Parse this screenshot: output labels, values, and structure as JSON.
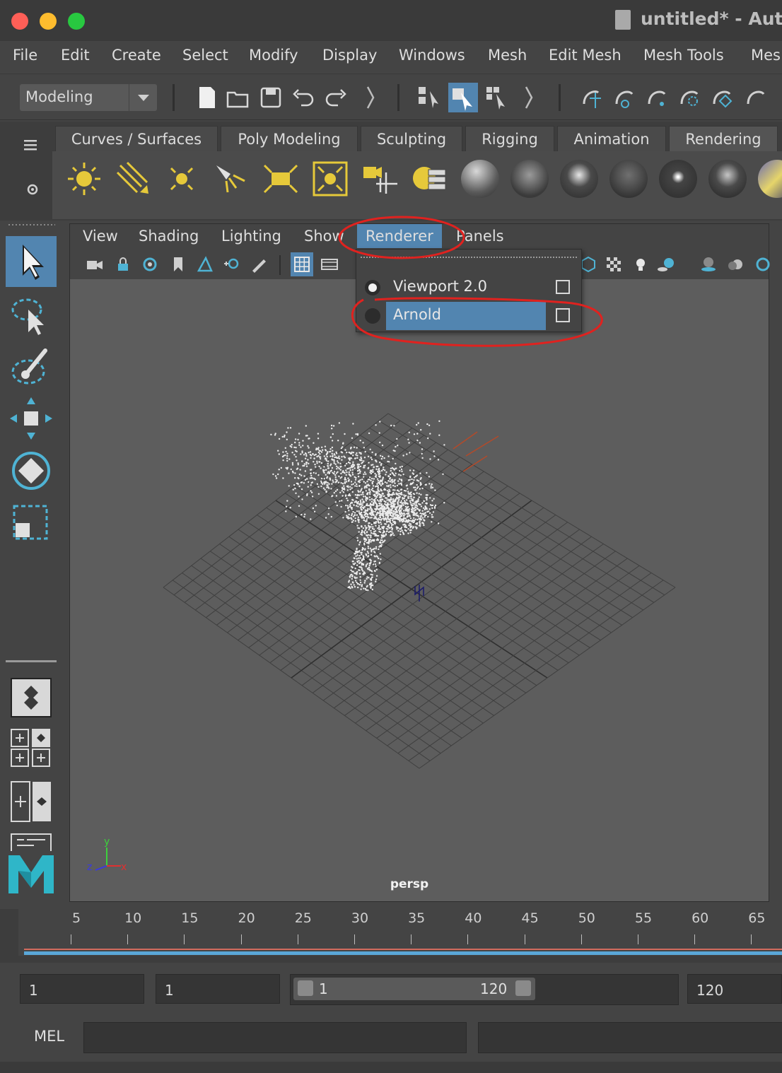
{
  "window": {
    "title": "untitled* - Auto"
  },
  "menubar": {
    "items": [
      "File",
      "Edit",
      "Create",
      "Select",
      "Modify",
      "Display",
      "Windows",
      "Mesh",
      "Edit Mesh",
      "Mesh Tools",
      "Mes"
    ]
  },
  "toolbar": {
    "mode": "Modeling"
  },
  "shelf": {
    "tabs": [
      "Curves / Surfaces",
      "Poly Modeling",
      "Sculpting",
      "Rigging",
      "Animation",
      "Rendering"
    ],
    "active_tab": "Rendering"
  },
  "panel": {
    "menus": [
      "View",
      "Shading",
      "Lighting",
      "Show",
      "Renderer",
      "Panels"
    ],
    "active_menu": "Renderer",
    "camera_label": "persp"
  },
  "renderer_menu": {
    "items": [
      {
        "label": "Viewport 2.0",
        "selected": true
      },
      {
        "label": "Arnold",
        "selected": false,
        "highlighted": true
      }
    ]
  },
  "timeline": {
    "ticks": [
      "5",
      "10",
      "15",
      "20",
      "25",
      "30",
      "35",
      "40",
      "45",
      "50",
      "55",
      "60",
      "65"
    ]
  },
  "range": {
    "start": "1",
    "current": "1",
    "slider_start": "1",
    "slider_end": "120",
    "end": "120"
  },
  "command": {
    "language": "MEL"
  },
  "axes": {
    "x": "x",
    "y": "y",
    "z": "z"
  },
  "colors": {
    "highlight": "#5285b0",
    "annotation": "#e0221f",
    "accent": "#4fb3d4"
  }
}
